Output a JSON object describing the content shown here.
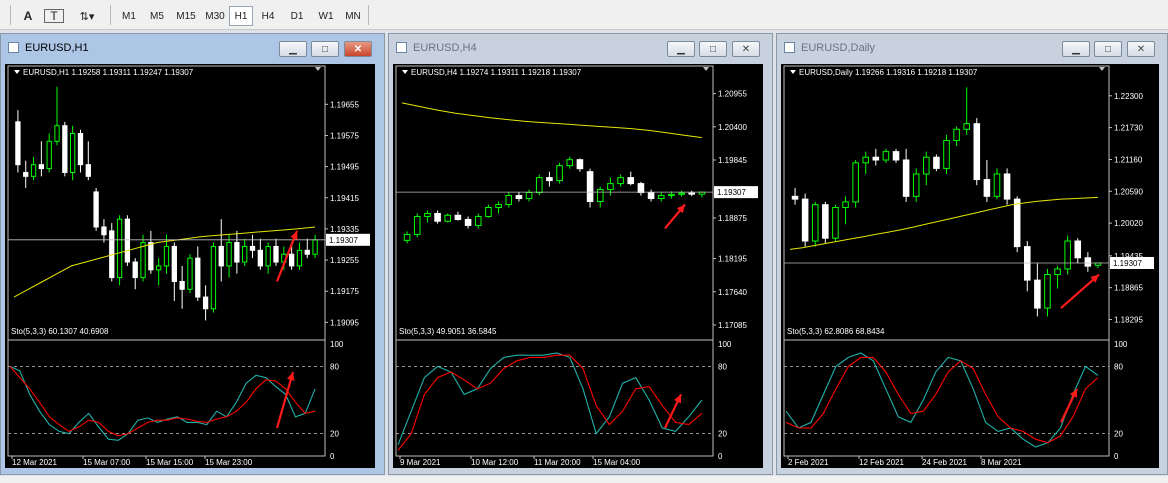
{
  "toolbar": {
    "buttons": [
      "A",
      "T"
    ],
    "timeframes": [
      "M1",
      "M5",
      "M15",
      "M30",
      "H1",
      "H4",
      "D1",
      "W1",
      "MN"
    ],
    "active_timeframe": "H1"
  },
  "colors": {
    "bull": "#00ff00",
    "bear": "#ffffff",
    "ma": "#e6e600",
    "stoch_main": "#20b2aa",
    "stoch_signal": "#ff0000",
    "arrow": "#ff1a1a",
    "grid": "#c0c0c0"
  },
  "windows": [
    {
      "title": "EURUSD,H1",
      "active": true,
      "info": "EURUSD,H1  1.19258 1.19311 1.19247 1.19307",
      "price_labels": [
        "1.19655",
        "1.19575",
        "1.19495",
        "1.19415",
        "1.19335",
        "1.19255",
        "1.19175",
        "1.19095"
      ],
      "current_price": "1.19307",
      "current_price_value": 1.19307,
      "price_range": [
        1.1906,
        1.1972
      ],
      "stoch_label": "Sto(5,3,3) 60.1307 40.6908",
      "stoch_levels": [
        "100",
        "80",
        "20",
        "0"
      ],
      "date_labels": [
        "12 Mar 2021",
        "15 Mar 07:00",
        "15 Mar 15:00",
        "15 Mar 23:00"
      ],
      "candles": [
        [
          1.1961,
          1.1964,
          1.1948,
          1.195
        ],
        [
          1.1948,
          1.1951,
          1.1944,
          1.1947
        ],
        [
          1.1947,
          1.1952,
          1.1946,
          1.195
        ],
        [
          1.195,
          1.1956,
          1.1947,
          1.1949
        ],
        [
          1.1949,
          1.1958,
          1.1948,
          1.1956
        ],
        [
          1.1956,
          1.197,
          1.1955,
          1.196
        ],
        [
          1.196,
          1.1961,
          1.1947,
          1.1948
        ],
        [
          1.1948,
          1.196,
          1.1946,
          1.1958
        ],
        [
          1.1958,
          1.1959,
          1.1948,
          1.195
        ],
        [
          1.195,
          1.1956,
          1.1946,
          1.1947
        ],
        [
          1.1943,
          1.1944,
          1.1933,
          1.1934
        ],
        [
          1.1934,
          1.1936,
          1.193,
          1.1932
        ],
        [
          1.1933,
          1.1935,
          1.192,
          1.1921
        ],
        [
          1.1921,
          1.1937,
          1.1919,
          1.1936
        ],
        [
          1.1936,
          1.1937,
          1.1924,
          1.1925
        ],
        [
          1.1925,
          1.1926,
          1.1918,
          1.1921
        ],
        [
          1.1921,
          1.1932,
          1.192,
          1.193
        ],
        [
          1.193,
          1.1933,
          1.1922,
          1.1923
        ],
        [
          1.1923,
          1.1926,
          1.1919,
          1.1924
        ],
        [
          1.1924,
          1.1932,
          1.1922,
          1.1929
        ],
        [
          1.1929,
          1.193,
          1.1915,
          1.192
        ],
        [
          1.192,
          1.1924,
          1.1913,
          1.1918
        ],
        [
          1.1918,
          1.1927,
          1.1917,
          1.1926
        ],
        [
          1.1926,
          1.1929,
          1.1915,
          1.1916
        ],
        [
          1.1916,
          1.1919,
          1.191,
          1.1913
        ],
        [
          1.1913,
          1.193,
          1.1912,
          1.1929
        ],
        [
          1.1929,
          1.1936,
          1.192,
          1.1924
        ],
        [
          1.1924,
          1.1932,
          1.1921,
          1.193
        ],
        [
          1.193,
          1.1933,
          1.1922,
          1.1925
        ],
        [
          1.1925,
          1.1931,
          1.1924,
          1.1929
        ],
        [
          1.1929,
          1.1932,
          1.1926,
          1.1928
        ],
        [
          1.1928,
          1.1931,
          1.1923,
          1.1924
        ],
        [
          1.1924,
          1.193,
          1.1922,
          1.1929
        ],
        [
          1.1929,
          1.1931,
          1.1924,
          1.1925
        ],
        [
          1.1925,
          1.1929,
          1.1923,
          1.1927
        ],
        [
          1.1927,
          1.193,
          1.1923,
          1.1924
        ],
        [
          1.1924,
          1.193,
          1.1923,
          1.1928
        ],
        [
          1.1928,
          1.1931,
          1.1926,
          1.1927
        ],
        [
          1.1927,
          1.1932,
          1.1926,
          1.19307
        ]
      ],
      "ma": [
        1.1916,
        1.1918,
        1.192,
        1.1922,
        1.1924,
        1.1925,
        1.1926,
        1.1927,
        1.1928,
        1.1929,
        1.193,
        1.19305,
        1.1931,
        1.19315,
        1.19318,
        1.19321,
        1.19324,
        1.19327,
        1.1933,
        1.19333,
        1.19336,
        1.1934
      ],
      "stoch_main": [
        80,
        76,
        55,
        40,
        28,
        22,
        20,
        30,
        38,
        26,
        15,
        14,
        20,
        32,
        34,
        30,
        33,
        35,
        30,
        30,
        28,
        40,
        35,
        48,
        65,
        72,
        70,
        62,
        55,
        35,
        38,
        60
      ],
      "stoch_signal": [
        80,
        70,
        60,
        48,
        35,
        28,
        22,
        26,
        32,
        30,
        22,
        18,
        20,
        25,
        30,
        32,
        32,
        34,
        33,
        31,
        30,
        33,
        35,
        40,
        48,
        60,
        68,
        67,
        60,
        48,
        38,
        40
      ],
      "arrow_price": [
        1.192,
        1.1933
      ],
      "arrow_stoch": [
        25,
        75
      ]
    },
    {
      "title": "EURUSD,H4",
      "active": false,
      "info": "EURUSD,H4  1.19274 1.19311 1.19218 1.19307",
      "price_labels": [
        "1.20955",
        "1.20400",
        "1.19845",
        "1.19307",
        "1.18875",
        "1.18195",
        "1.17640",
        "1.17085"
      ],
      "current_price": "1.19307",
      "current_price_value": 1.19307,
      "price_range": [
        1.169,
        1.212
      ],
      "stoch_label": "Sto(5,3,3) 49.9051 36.5845",
      "stoch_levels": [
        "100",
        "80",
        "20",
        "0"
      ],
      "date_labels": [
        "9 Mar 2021",
        "10 Mar 12:00",
        "11 Mar 20:00",
        "15 Mar 04:00"
      ],
      "candles": [
        [
          1.185,
          1.1865,
          1.1845,
          1.186
        ],
        [
          1.186,
          1.1895,
          1.1855,
          1.189
        ],
        [
          1.189,
          1.19,
          1.188,
          1.1895
        ],
        [
          1.1895,
          1.19,
          1.1878,
          1.1882
        ],
        [
          1.1882,
          1.1895,
          1.188,
          1.1892
        ],
        [
          1.1892,
          1.1898,
          1.1883,
          1.1885
        ],
        [
          1.1885,
          1.189,
          1.187,
          1.1875
        ],
        [
          1.1875,
          1.1895,
          1.187,
          1.189
        ],
        [
          1.189,
          1.191,
          1.1888,
          1.1905
        ],
        [
          1.1905,
          1.1915,
          1.1895,
          1.191
        ],
        [
          1.191,
          1.193,
          1.1905,
          1.1925
        ],
        [
          1.1925,
          1.193,
          1.1915,
          1.192
        ],
        [
          1.192,
          1.1935,
          1.1915,
          1.193
        ],
        [
          1.193,
          1.196,
          1.1925,
          1.1955
        ],
        [
          1.1955,
          1.1965,
          1.194,
          1.195
        ],
        [
          1.195,
          1.198,
          1.1945,
          1.1975
        ],
        [
          1.1975,
          1.199,
          1.197,
          1.1985
        ],
        [
          1.1985,
          1.1987,
          1.1965,
          1.197
        ],
        [
          1.1965,
          1.197,
          1.1905,
          1.1915
        ],
        [
          1.1915,
          1.194,
          1.1905,
          1.1935
        ],
        [
          1.1935,
          1.1955,
          1.1925,
          1.1945
        ],
        [
          1.1945,
          1.196,
          1.194,
          1.1955
        ],
        [
          1.1955,
          1.1965,
          1.1942,
          1.1945
        ],
        [
          1.1945,
          1.1948,
          1.1925,
          1.193
        ],
        [
          1.193,
          1.1935,
          1.1915,
          1.192
        ],
        [
          1.192,
          1.193,
          1.1915,
          1.1925
        ],
        [
          1.1925,
          1.1932,
          1.192,
          1.1927
        ],
        [
          1.1927,
          1.1933,
          1.1923,
          1.1929
        ],
        [
          1.1929,
          1.1933,
          1.1924,
          1.1928
        ],
        [
          1.19274,
          1.19311,
          1.19218,
          1.19307
        ]
      ],
      "ma": [
        1.208,
        1.2074,
        1.2068,
        1.2063,
        1.2059,
        1.2055,
        1.2052,
        1.2049,
        1.2047,
        1.2045,
        1.2043,
        1.2041,
        1.2039,
        1.2037,
        1.2034,
        1.203,
        1.2026,
        1.2022
      ],
      "stoch_main": [
        10,
        40,
        70,
        80,
        75,
        55,
        60,
        78,
        88,
        90,
        90,
        90,
        92,
        88,
        60,
        20,
        35,
        65,
        70,
        50,
        25,
        22,
        35,
        50
      ],
      "stoch_signal": [
        5,
        20,
        55,
        70,
        75,
        68,
        60,
        65,
        78,
        85,
        88,
        88,
        90,
        90,
        78,
        45,
        28,
        40,
        60,
        62,
        45,
        30,
        28,
        38
      ],
      "arrow_price": [
        1.187,
        1.191
      ],
      "arrow_stoch": [
        25,
        55
      ]
    },
    {
      "title": "EURUSD,Daily",
      "active": false,
      "info": "EURUSD,Daily  1.19266 1.19316 1.19218 1.19307",
      "price_labels": [
        "1.22300",
        "1.21730",
        "1.21160",
        "1.20590",
        "1.20020",
        "1.19435",
        "1.19307",
        "1.18865",
        "1.18295"
      ],
      "current_price": "1.19307",
      "current_price_value": 1.19307,
      "price_range": [
        1.18,
        1.226
      ],
      "stoch_label": "Sto(5,3,3) 62.8086 68.8434",
      "stoch_levels": [
        "100",
        "80",
        "20",
        "0"
      ],
      "date_labels": [
        "2 Feb 2021",
        "12 Feb 2021",
        "24 Feb 2021",
        "8 Mar 2021"
      ],
      "candles": [
        [
          1.205,
          1.2065,
          1.2035,
          1.2045
        ],
        [
          1.2045,
          1.2055,
          1.196,
          1.197
        ],
        [
          1.197,
          1.204,
          1.196,
          1.2035
        ],
        [
          1.2035,
          1.204,
          1.1965,
          1.1975
        ],
        [
          1.1975,
          1.2035,
          1.197,
          1.203
        ],
        [
          1.203,
          1.205,
          1.2,
          1.204
        ],
        [
          1.204,
          1.2115,
          1.203,
          1.211
        ],
        [
          1.211,
          1.213,
          1.209,
          1.212
        ],
        [
          1.212,
          1.2135,
          1.2105,
          1.2115
        ],
        [
          1.2115,
          1.2135,
          1.211,
          1.213
        ],
        [
          1.213,
          1.2135,
          1.211,
          1.2115
        ],
        [
          1.2115,
          1.2135,
          1.204,
          1.205
        ],
        [
          1.205,
          1.21,
          1.204,
          1.209
        ],
        [
          1.209,
          1.213,
          1.207,
          1.212
        ],
        [
          1.212,
          1.2125,
          1.2095,
          1.21
        ],
        [
          1.21,
          1.216,
          1.209,
          1.215
        ],
        [
          1.215,
          1.2175,
          1.214,
          1.217
        ],
        [
          1.217,
          1.2245,
          1.216,
          1.218
        ],
        [
          1.218,
          1.219,
          1.207,
          1.208
        ],
        [
          1.208,
          1.2115,
          1.204,
          1.205
        ],
        [
          1.205,
          1.21,
          1.2045,
          1.209
        ],
        [
          1.209,
          1.21,
          1.2035,
          1.2045
        ],
        [
          1.2045,
          1.205,
          1.195,
          1.196
        ],
        [
          1.196,
          1.197,
          1.188,
          1.19
        ],
        [
          1.19,
          1.193,
          1.1835,
          1.185
        ],
        [
          1.185,
          1.192,
          1.1835,
          1.191
        ],
        [
          1.191,
          1.1925,
          1.1885,
          1.192
        ],
        [
          1.192,
          1.198,
          1.191,
          1.197
        ],
        [
          1.197,
          1.1975,
          1.193,
          1.194
        ],
        [
          1.194,
          1.195,
          1.1915,
          1.1925
        ],
        [
          1.19266,
          1.19316,
          1.19218,
          1.19307
        ]
      ],
      "ma": [
        1.1955,
        1.1958,
        1.1962,
        1.1966,
        1.197,
        1.1974,
        1.1978,
        1.1982,
        1.1986,
        1.199,
        1.1995,
        1.2,
        1.2005,
        1.201,
        1.2015,
        1.202,
        1.2025,
        1.203,
        1.2035,
        1.2038,
        1.2041,
        1.2043,
        1.2045,
        1.2046,
        1.2047,
        1.2048
      ],
      "stoch_main": [
        40,
        25,
        30,
        55,
        80,
        88,
        92,
        85,
        60,
        35,
        30,
        50,
        75,
        88,
        85,
        60,
        30,
        22,
        25,
        15,
        8,
        12,
        25,
        55,
        80,
        72
      ],
      "stoch_signal": [
        30,
        25,
        25,
        38,
        60,
        80,
        88,
        88,
        75,
        55,
        38,
        40,
        55,
        75,
        85,
        78,
        55,
        35,
        25,
        22,
        15,
        12,
        18,
        35,
        60,
        70
      ],
      "arrow_price": [
        1.185,
        1.191
      ],
      "arrow_stoch": [
        30,
        60
      ]
    }
  ]
}
